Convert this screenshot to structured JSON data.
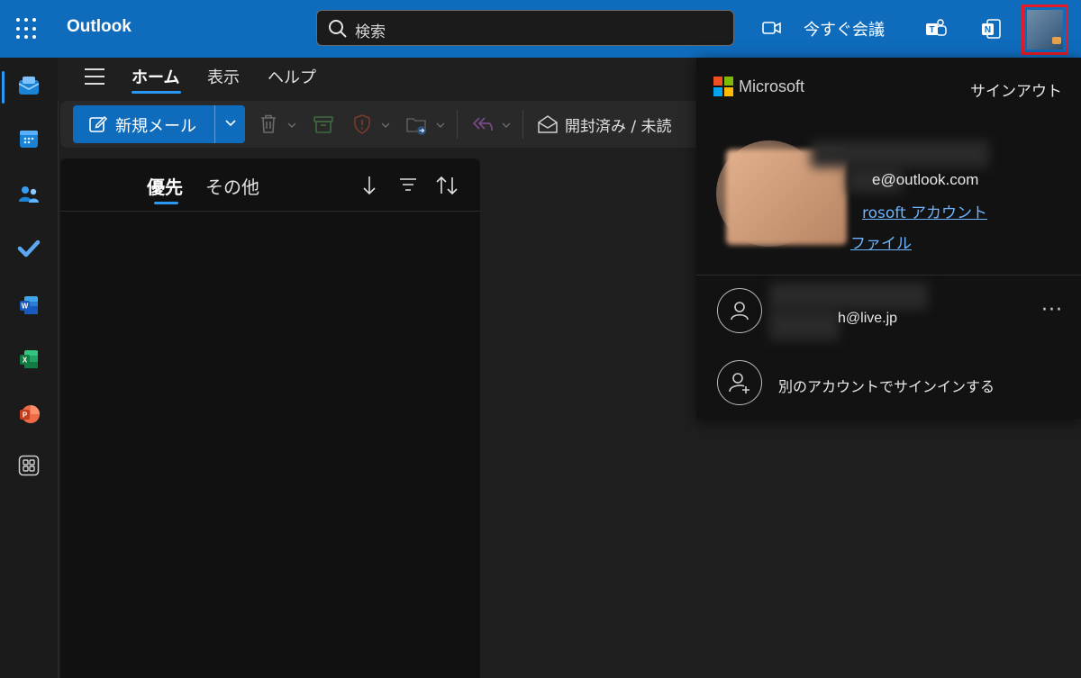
{
  "app": {
    "title": "Outlook"
  },
  "search": {
    "placeholder": "検索"
  },
  "header": {
    "meet_now_label": "今すぐ会議"
  },
  "ribbon": {
    "tabs": [
      {
        "label": "ホーム",
        "active": true
      },
      {
        "label": "表示",
        "active": false
      },
      {
        "label": "ヘルプ",
        "active": false
      }
    ],
    "new_mail_label": "新規メール",
    "read_unread_label": "開封済み / 未読"
  },
  "mail_list": {
    "focused_label": "優先",
    "other_label": "その他"
  },
  "account_panel": {
    "brand": "Microsoft",
    "sign_out_label": "サインアウト",
    "primary_email_visible": "e@outlook.com",
    "account_link_visible": "rosoft アカウント",
    "profile_link_visible": "ファイル",
    "secondary_email_visible": "h@live.jp",
    "more_label": "···",
    "add_account_label": "別のアカウントでサインインする"
  },
  "colors": {
    "brand_blue": "#0f6cbd",
    "highlight_red": "#e51c23",
    "link_blue": "#6cb4ff"
  }
}
